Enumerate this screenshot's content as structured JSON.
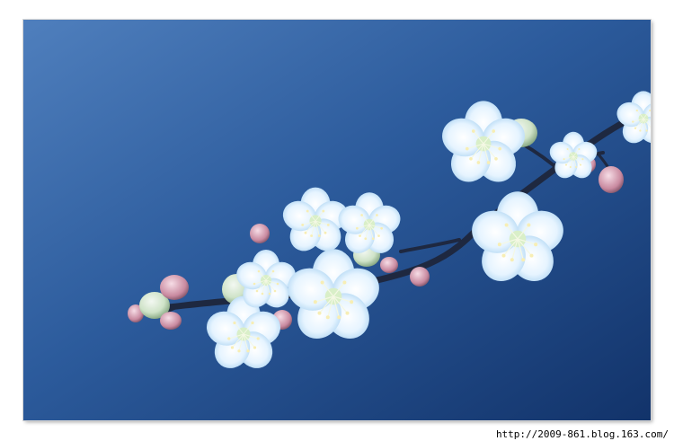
{
  "watermark": {
    "text": "http://2009-861.blog.163.com/"
  },
  "colors": {
    "page_background": "#ffffff",
    "sky_light": "#4f82c0",
    "sky_dark": "#12356a",
    "petal": "#eaf6ff",
    "petal_shade": "#b9dcf6",
    "branch": "#1f2a44",
    "bud_pink": "#c98aa0",
    "bud_green": "#8fb486"
  },
  "photo": {
    "subject": "plum-blossom-branch"
  }
}
